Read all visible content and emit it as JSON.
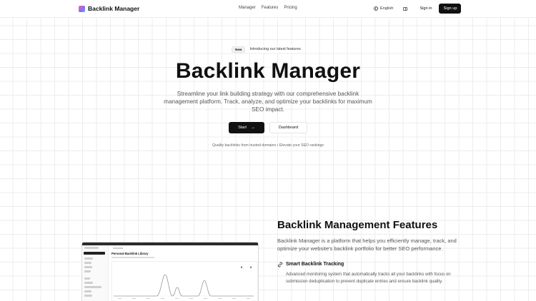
{
  "nav": {
    "brand": "Backlink Manager",
    "links": [
      "Manager",
      "Features",
      "Pricing"
    ],
    "language": "English",
    "signin": "Sign in",
    "signup": "Sign up"
  },
  "hero": {
    "badge_new": "New",
    "badge_text": "Introducing our latest features",
    "title": "Backlink Manager",
    "subtitle": "Streamline your link building strategy with our comprehensive backlink management platform. Track, analyze, and optimize your backlinks for maximum SEO impact.",
    "start_label": "Start",
    "dashboard_label": "Dashboard",
    "note": "Quality backlinks from trusted domains • Elevate your SEO rankings"
  },
  "features": {
    "title": "Backlink Management Features",
    "description": "Backlink Manager is a platform that helps you efficiently manage, track, and optimize your website's backlink portfolio for better SEO performance.",
    "items": [
      {
        "title": "Smart Backlink Tracking",
        "description": "Advanced monitoring system that automatically tracks all your backlinks with focus on submission deduplication to prevent duplicate entries and ensure backlink quality."
      }
    ]
  },
  "preview": {
    "title": "Personal Backlink Library",
    "stat_1": "0",
    "stat_2": "0"
  },
  "icons": {
    "globe": "globe-icon",
    "book": "book-icon",
    "arrow": "arrow-right-icon",
    "link": "link-icon"
  },
  "colors": {
    "primary": "#111111",
    "muted_text": "#555555",
    "grid_line": "#ededed"
  }
}
